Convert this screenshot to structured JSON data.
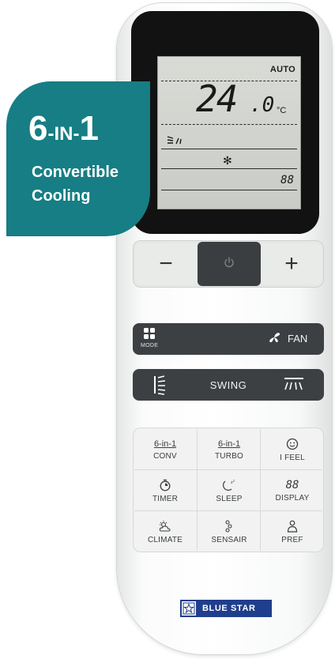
{
  "badge": {
    "big_num": "6",
    "big_mid": "-IN-",
    "big_end": "1",
    "line2": "Convertible",
    "line3": "Cooling"
  },
  "lcd": {
    "mode": "AUTO",
    "temperature": "24",
    "temperature_decimal": ".0",
    "unit": "°C",
    "snow": "✻",
    "fan_segment": "88"
  },
  "controls": {
    "minus": "−",
    "plus": "+"
  },
  "mode_bar": {
    "mode_label": "MODE",
    "fan_label": "FAN"
  },
  "swing_bar": {
    "label": "SWING"
  },
  "grid": {
    "conv_top": "6-in-1",
    "conv_label": "CONV",
    "turbo_top": "6-in-1",
    "turbo_label": "TURBO",
    "ifeel_label": "I FEEL",
    "timer_label": "TIMER",
    "sleep_label": "SLEEP",
    "display_top": "88",
    "display_label": "DISPLAY",
    "climate_label": "CLIMATE",
    "sensair_label": "SENSAIR",
    "pref_label": "PREF"
  },
  "brand": {
    "name": "BLUE STAR"
  },
  "colors": {
    "badge": "#167e84",
    "dark_buttons": "#3d4043",
    "lcd": "#d9dbd6",
    "brand_blue": "#1f3e8c"
  }
}
